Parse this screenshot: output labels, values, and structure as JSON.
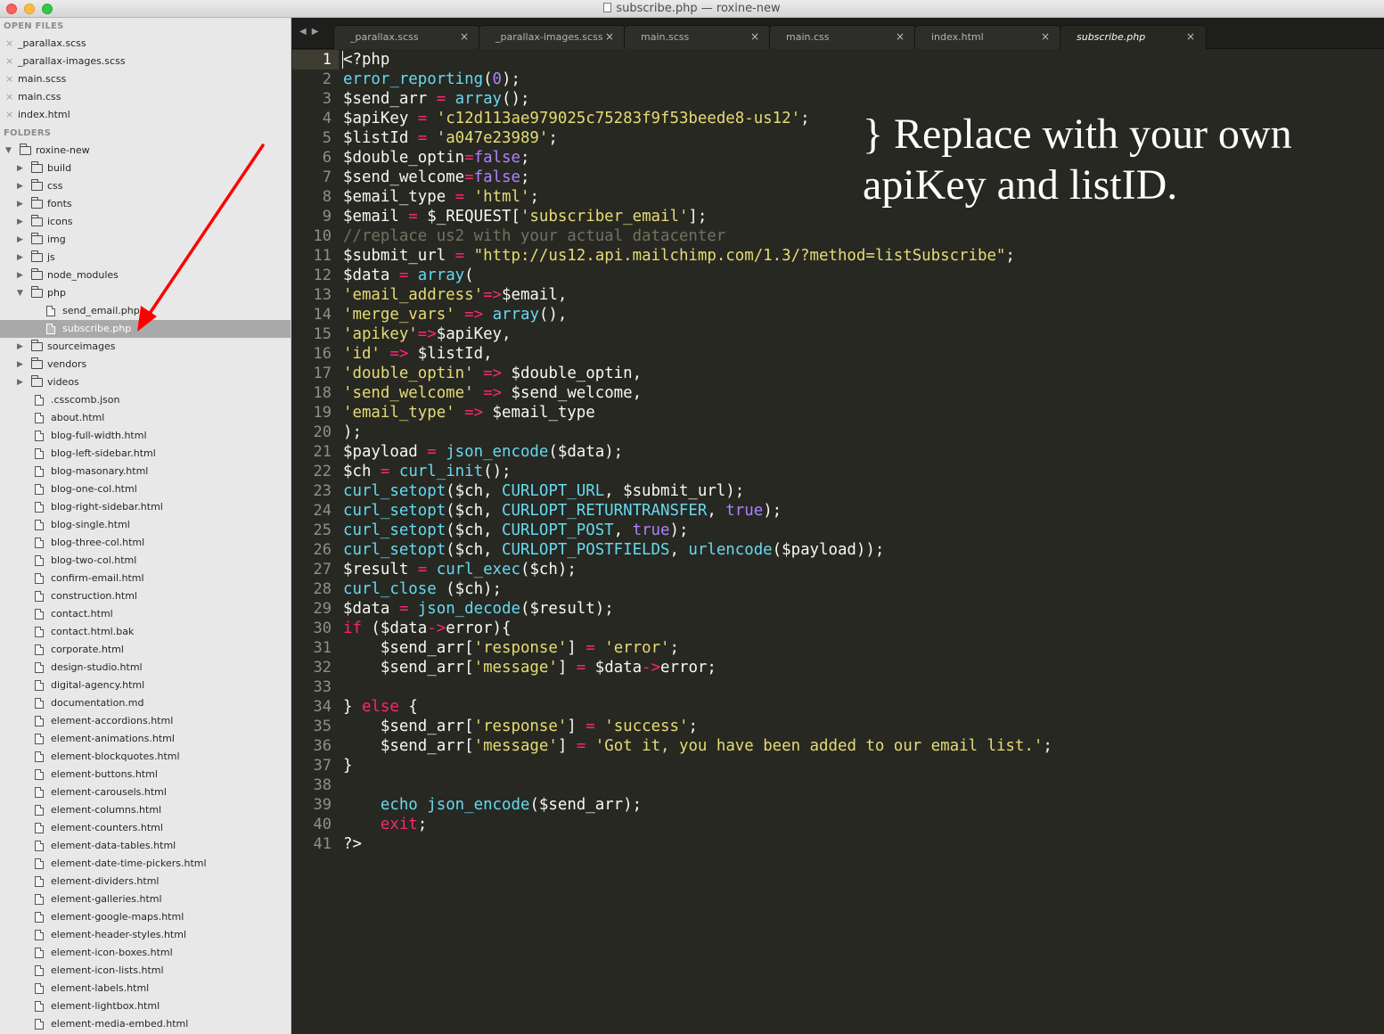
{
  "window": {
    "title": "subscribe.php — roxine-new"
  },
  "sidebar": {
    "open_files_header": "OPEN FILES",
    "open_files": [
      {
        "label": "_parallax.scss"
      },
      {
        "label": "_parallax-images.scss"
      },
      {
        "label": "main.scss"
      },
      {
        "label": "main.css"
      },
      {
        "label": "index.html"
      }
    ],
    "folders_header": "FOLDERS",
    "tree": [
      {
        "label": "roxine-new",
        "kind": "folder",
        "depth": 0,
        "expanded": true
      },
      {
        "label": "build",
        "kind": "folder",
        "depth": 1,
        "expanded": false
      },
      {
        "label": "css",
        "kind": "folder",
        "depth": 1,
        "expanded": false
      },
      {
        "label": "fonts",
        "kind": "folder",
        "depth": 1,
        "expanded": false
      },
      {
        "label": "icons",
        "kind": "folder",
        "depth": 1,
        "expanded": false
      },
      {
        "label": "img",
        "kind": "folder",
        "depth": 1,
        "expanded": false
      },
      {
        "label": "js",
        "kind": "folder",
        "depth": 1,
        "expanded": false
      },
      {
        "label": "node_modules",
        "kind": "folder",
        "depth": 1,
        "expanded": false
      },
      {
        "label": "php",
        "kind": "folder",
        "depth": 1,
        "expanded": true
      },
      {
        "label": "send_email.php",
        "kind": "file",
        "depth": 2
      },
      {
        "label": "subscribe.php",
        "kind": "file",
        "depth": 2,
        "selected": true
      },
      {
        "label": "sourceimages",
        "kind": "folder",
        "depth": 1,
        "expanded": false
      },
      {
        "label": "vendors",
        "kind": "folder",
        "depth": 1,
        "expanded": false
      },
      {
        "label": "videos",
        "kind": "folder",
        "depth": 1,
        "expanded": false
      },
      {
        "label": ".csscomb.json",
        "kind": "file",
        "depth": 1
      },
      {
        "label": "about.html",
        "kind": "file",
        "depth": 1
      },
      {
        "label": "blog-full-width.html",
        "kind": "file",
        "depth": 1
      },
      {
        "label": "blog-left-sidebar.html",
        "kind": "file",
        "depth": 1
      },
      {
        "label": "blog-masonary.html",
        "kind": "file",
        "depth": 1
      },
      {
        "label": "blog-one-col.html",
        "kind": "file",
        "depth": 1
      },
      {
        "label": "blog-right-sidebar.html",
        "kind": "file",
        "depth": 1
      },
      {
        "label": "blog-single.html",
        "kind": "file",
        "depth": 1
      },
      {
        "label": "blog-three-col.html",
        "kind": "file",
        "depth": 1
      },
      {
        "label": "blog-two-col.html",
        "kind": "file",
        "depth": 1
      },
      {
        "label": "confirm-email.html",
        "kind": "file",
        "depth": 1
      },
      {
        "label": "construction.html",
        "kind": "file",
        "depth": 1
      },
      {
        "label": "contact.html",
        "kind": "file",
        "depth": 1
      },
      {
        "label": "contact.html.bak",
        "kind": "file",
        "depth": 1
      },
      {
        "label": "corporate.html",
        "kind": "file",
        "depth": 1
      },
      {
        "label": "design-studio.html",
        "kind": "file",
        "depth": 1
      },
      {
        "label": "digital-agency.html",
        "kind": "file",
        "depth": 1
      },
      {
        "label": "documentation.md",
        "kind": "file",
        "depth": 1
      },
      {
        "label": "element-accordions.html",
        "kind": "file",
        "depth": 1
      },
      {
        "label": "element-animations.html",
        "kind": "file",
        "depth": 1
      },
      {
        "label": "element-blockquotes.html",
        "kind": "file",
        "depth": 1
      },
      {
        "label": "element-buttons.html",
        "kind": "file",
        "depth": 1
      },
      {
        "label": "element-carousels.html",
        "kind": "file",
        "depth": 1
      },
      {
        "label": "element-columns.html",
        "kind": "file",
        "depth": 1
      },
      {
        "label": "element-counters.html",
        "kind": "file",
        "depth": 1
      },
      {
        "label": "element-data-tables.html",
        "kind": "file",
        "depth": 1
      },
      {
        "label": "element-date-time-pickers.html",
        "kind": "file",
        "depth": 1
      },
      {
        "label": "element-dividers.html",
        "kind": "file",
        "depth": 1
      },
      {
        "label": "element-galleries.html",
        "kind": "file",
        "depth": 1
      },
      {
        "label": "element-google-maps.html",
        "kind": "file",
        "depth": 1
      },
      {
        "label": "element-header-styles.html",
        "kind": "file",
        "depth": 1
      },
      {
        "label": "element-icon-boxes.html",
        "kind": "file",
        "depth": 1
      },
      {
        "label": "element-icon-lists.html",
        "kind": "file",
        "depth": 1
      },
      {
        "label": "element-labels.html",
        "kind": "file",
        "depth": 1
      },
      {
        "label": "element-lightbox.html",
        "kind": "file",
        "depth": 1
      },
      {
        "label": "element-media-embed.html",
        "kind": "file",
        "depth": 1
      }
    ]
  },
  "tabbar": {
    "nav_back": "◀",
    "nav_forward": "▶",
    "close_glyph": "×",
    "tabs": [
      {
        "label": "_parallax.scss",
        "active": false
      },
      {
        "label": "_parallax-images.scss",
        "active": false
      },
      {
        "label": "main.scss",
        "active": false
      },
      {
        "label": "main.css",
        "active": false
      },
      {
        "label": "index.html",
        "active": false
      },
      {
        "label": "subscribe.php",
        "active": true
      }
    ]
  },
  "editor": {
    "current_line": 1,
    "syntax_colors": {
      "keyword": "#f92672",
      "string": "#e6db74",
      "function": "#66d9ef",
      "constant": "#ae81ff",
      "comment": "#75715e",
      "plain": "#f8f8f2",
      "background": "#272822"
    },
    "lines": [
      [
        [
          "p",
          "<?php"
        ]
      ],
      [
        [
          "f",
          "error_reporting"
        ],
        [
          "p",
          "("
        ],
        [
          "c",
          "0"
        ],
        [
          "p",
          ");"
        ]
      ],
      [
        [
          "p",
          "$send_arr "
        ],
        [
          "k",
          "="
        ],
        [
          "p",
          " "
        ],
        [
          "f",
          "array"
        ],
        [
          "p",
          "();"
        ]
      ],
      [
        [
          "p",
          "$apiKey "
        ],
        [
          "k",
          "="
        ],
        [
          "p",
          " "
        ],
        [
          "s",
          "'c12d113ae979025c75283f9f53beede8-us12'"
        ],
        [
          "p",
          ";"
        ]
      ],
      [
        [
          "p",
          "$listId "
        ],
        [
          "k",
          "="
        ],
        [
          "p",
          " "
        ],
        [
          "s",
          "'a047e23989'"
        ],
        [
          "p",
          ";"
        ]
      ],
      [
        [
          "p",
          "$double_optin"
        ],
        [
          "k",
          "="
        ],
        [
          "c",
          "false"
        ],
        [
          "p",
          ";"
        ]
      ],
      [
        [
          "p",
          "$send_welcome"
        ],
        [
          "k",
          "="
        ],
        [
          "c",
          "false"
        ],
        [
          "p",
          ";"
        ]
      ],
      [
        [
          "p",
          "$email_type "
        ],
        [
          "k",
          "="
        ],
        [
          "p",
          " "
        ],
        [
          "s",
          "'html'"
        ],
        [
          "p",
          ";"
        ]
      ],
      [
        [
          "p",
          "$email "
        ],
        [
          "k",
          "="
        ],
        [
          "p",
          " $_REQUEST["
        ],
        [
          "s",
          "'subscriber_email'"
        ],
        [
          "p",
          "];"
        ]
      ],
      [
        [
          "m",
          "//replace us2 with your actual datacenter"
        ]
      ],
      [
        [
          "p",
          "$submit_url "
        ],
        [
          "k",
          "="
        ],
        [
          "p",
          " "
        ],
        [
          "s",
          "\"http://us12.api.mailchimp.com/1.3/?method=listSubscribe\""
        ],
        [
          "p",
          ";"
        ]
      ],
      [
        [
          "p",
          "$data "
        ],
        [
          "k",
          "="
        ],
        [
          "p",
          " "
        ],
        [
          "f",
          "array"
        ],
        [
          "p",
          "("
        ]
      ],
      [
        [
          "s",
          "'email_address'"
        ],
        [
          "k",
          "=>"
        ],
        [
          "p",
          "$email,"
        ]
      ],
      [
        [
          "s",
          "'merge_vars'"
        ],
        [
          "p",
          " "
        ],
        [
          "k",
          "=>"
        ],
        [
          "p",
          " "
        ],
        [
          "f",
          "array"
        ],
        [
          "p",
          "(),"
        ]
      ],
      [
        [
          "s",
          "'apikey'"
        ],
        [
          "k",
          "=>"
        ],
        [
          "p",
          "$apiKey,"
        ]
      ],
      [
        [
          "s",
          "'id'"
        ],
        [
          "p",
          " "
        ],
        [
          "k",
          "=>"
        ],
        [
          "p",
          " $listId,"
        ]
      ],
      [
        [
          "s",
          "'double_optin'"
        ],
        [
          "p",
          " "
        ],
        [
          "k",
          "=>"
        ],
        [
          "p",
          " $double_optin,"
        ]
      ],
      [
        [
          "s",
          "'send_welcome'"
        ],
        [
          "p",
          " "
        ],
        [
          "k",
          "=>"
        ],
        [
          "p",
          " $send_welcome,"
        ]
      ],
      [
        [
          "s",
          "'email_type'"
        ],
        [
          "p",
          " "
        ],
        [
          "k",
          "=>"
        ],
        [
          "p",
          " $email_type"
        ]
      ],
      [
        [
          "p",
          ");"
        ]
      ],
      [
        [
          "p",
          "$payload "
        ],
        [
          "k",
          "="
        ],
        [
          "p",
          " "
        ],
        [
          "f",
          "json_encode"
        ],
        [
          "p",
          "($data);"
        ]
      ],
      [
        [
          "p",
          "$ch "
        ],
        [
          "k",
          "="
        ],
        [
          "p",
          " "
        ],
        [
          "f",
          "curl_init"
        ],
        [
          "p",
          "();"
        ]
      ],
      [
        [
          "f",
          "curl_setopt"
        ],
        [
          "p",
          "($ch, "
        ],
        [
          "f",
          "CURLOPT_URL"
        ],
        [
          "p",
          ", $submit_url);"
        ]
      ],
      [
        [
          "f",
          "curl_setopt"
        ],
        [
          "p",
          "($ch, "
        ],
        [
          "f",
          "CURLOPT_RETURNTRANSFER"
        ],
        [
          "p",
          ", "
        ],
        [
          "c",
          "true"
        ],
        [
          "p",
          ");"
        ]
      ],
      [
        [
          "f",
          "curl_setopt"
        ],
        [
          "p",
          "($ch, "
        ],
        [
          "f",
          "CURLOPT_POST"
        ],
        [
          "p",
          ", "
        ],
        [
          "c",
          "true"
        ],
        [
          "p",
          ");"
        ]
      ],
      [
        [
          "f",
          "curl_setopt"
        ],
        [
          "p",
          "($ch, "
        ],
        [
          "f",
          "CURLOPT_POSTFIELDS"
        ],
        [
          "p",
          ", "
        ],
        [
          "f",
          "urlencode"
        ],
        [
          "p",
          "($payload));"
        ]
      ],
      [
        [
          "p",
          "$result "
        ],
        [
          "k",
          "="
        ],
        [
          "p",
          " "
        ],
        [
          "f",
          "curl_exec"
        ],
        [
          "p",
          "($ch);"
        ]
      ],
      [
        [
          "f",
          "curl_close"
        ],
        [
          "p",
          " ($ch);"
        ]
      ],
      [
        [
          "p",
          "$data "
        ],
        [
          "k",
          "="
        ],
        [
          "p",
          " "
        ],
        [
          "f",
          "json_decode"
        ],
        [
          "p",
          "($result);"
        ]
      ],
      [
        [
          "k",
          "if"
        ],
        [
          "p",
          " ($data"
        ],
        [
          "k",
          "->"
        ],
        [
          "p",
          "error){"
        ]
      ],
      [
        [
          "p",
          "    $send_arr["
        ],
        [
          "s",
          "'response'"
        ],
        [
          "p",
          "] "
        ],
        [
          "k",
          "="
        ],
        [
          "p",
          " "
        ],
        [
          "s",
          "'error'"
        ],
        [
          "p",
          ";"
        ]
      ],
      [
        [
          "p",
          "    $send_arr["
        ],
        [
          "s",
          "'message'"
        ],
        [
          "p",
          "] "
        ],
        [
          "k",
          "="
        ],
        [
          "p",
          " $data"
        ],
        [
          "k",
          "->"
        ],
        [
          "p",
          "error;"
        ]
      ],
      [],
      [
        [
          "p",
          "} "
        ],
        [
          "k",
          "else"
        ],
        [
          "p",
          " {"
        ]
      ],
      [
        [
          "p",
          "    $send_arr["
        ],
        [
          "s",
          "'response'"
        ],
        [
          "p",
          "] "
        ],
        [
          "k",
          "="
        ],
        [
          "p",
          " "
        ],
        [
          "s",
          "'success'"
        ],
        [
          "p",
          ";"
        ]
      ],
      [
        [
          "p",
          "    $send_arr["
        ],
        [
          "s",
          "'message'"
        ],
        [
          "p",
          "] "
        ],
        [
          "k",
          "="
        ],
        [
          "p",
          " "
        ],
        [
          "s",
          "'Got it, you have been added to our email list.'"
        ],
        [
          "p",
          ";"
        ]
      ],
      [
        [
          "p",
          "}"
        ]
      ],
      [],
      [
        [
          "p",
          "    "
        ],
        [
          "f",
          "echo"
        ],
        [
          "p",
          " "
        ],
        [
          "f",
          "json_encode"
        ],
        [
          "p",
          "($send_arr);"
        ]
      ],
      [
        [
          "p",
          "    "
        ],
        [
          "k",
          "exit"
        ],
        [
          "p",
          ";"
        ]
      ],
      [
        [
          "p",
          "?>"
        ]
      ]
    ]
  },
  "annotation": {
    "text": "} Replace with your own apiKey and listID.",
    "color": "#ffffff",
    "arrow_color": "#ff0000",
    "arrow_target": "subscribe.php"
  }
}
